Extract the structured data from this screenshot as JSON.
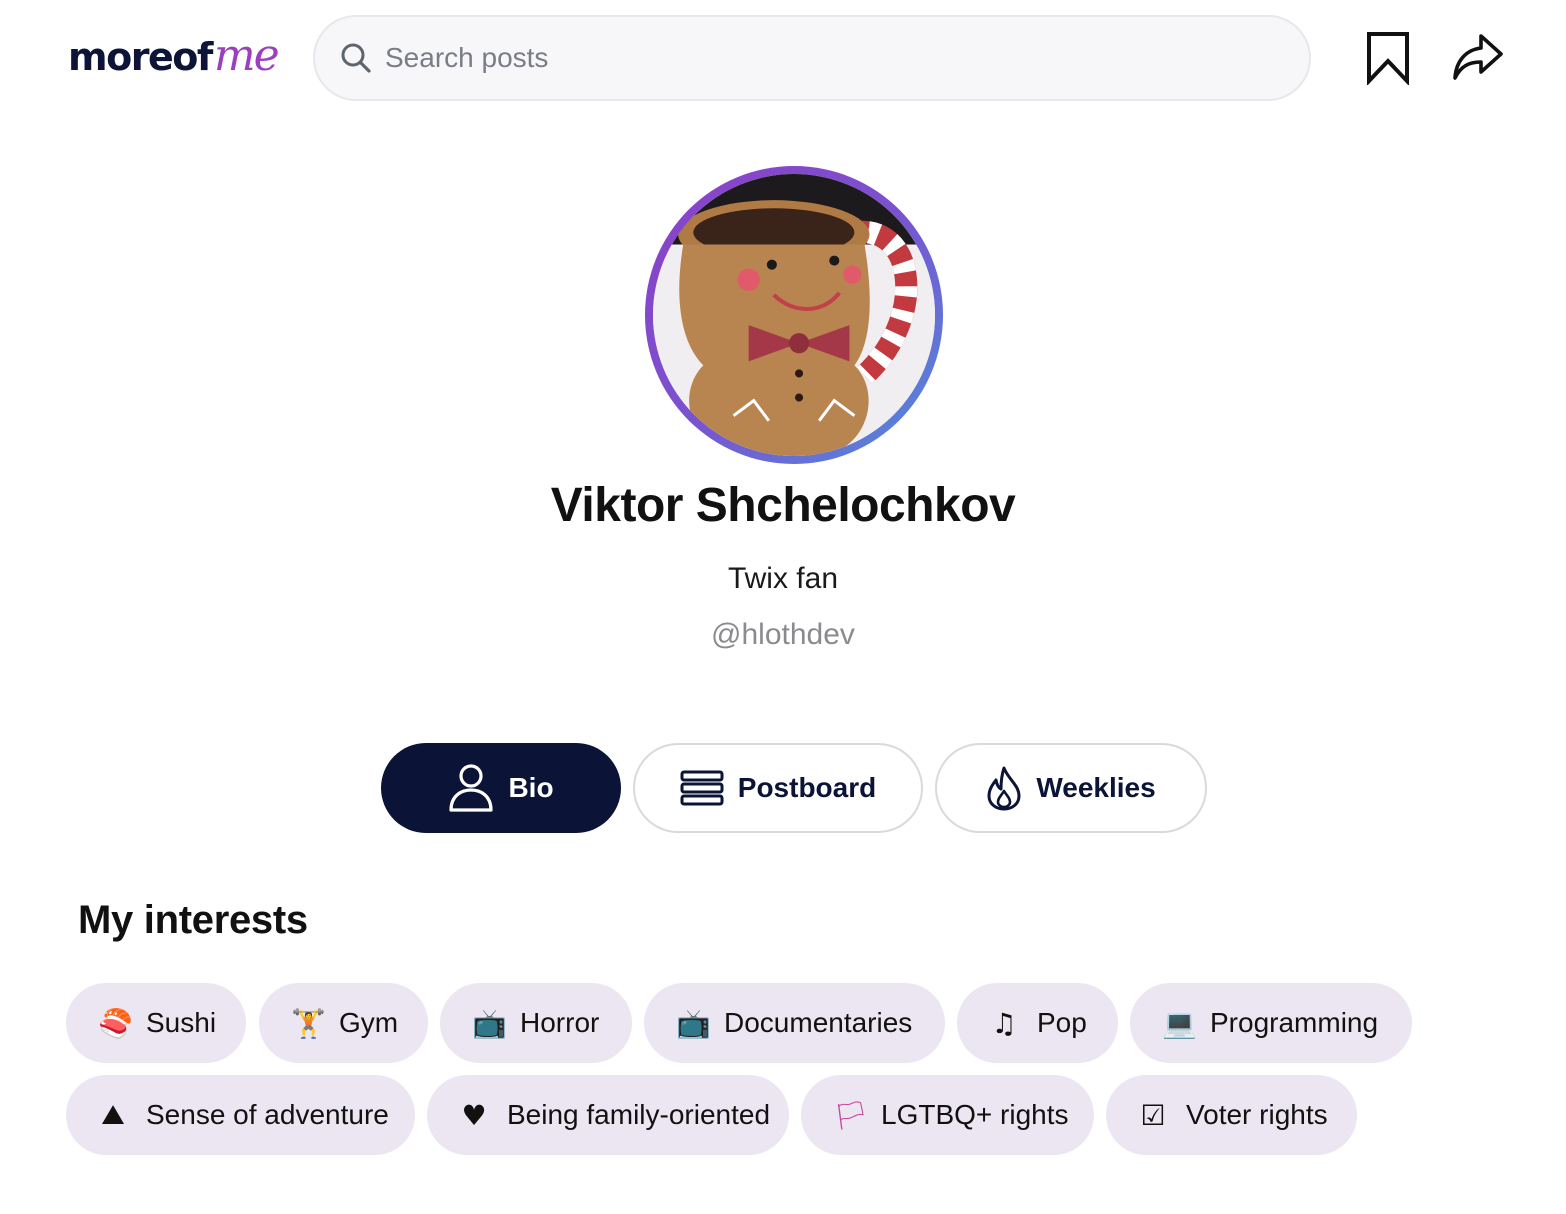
{
  "header": {
    "logo": {
      "part1": "moreof",
      "part2": "me"
    },
    "search": {
      "placeholder": "Search posts",
      "value": ""
    },
    "bookmark_icon": "bookmark-icon",
    "share_icon": "share-icon"
  },
  "profile": {
    "name": "Viktor Shchelochkov",
    "bio": "Twix fan",
    "handle": "@hlothdev",
    "avatar_ring_colors": [
      "#8d3fc7",
      "#4f8fdd"
    ]
  },
  "tabs": [
    {
      "label": "Bio",
      "icon": "person-icon",
      "active": true
    },
    {
      "label": "Postboard",
      "icon": "list-icon",
      "active": false
    },
    {
      "label": "Weeklies",
      "icon": "flame-icon",
      "active": false
    }
  ],
  "interests": {
    "title": "My interests",
    "items": [
      {
        "emoji": "🍣",
        "label": "Sushi"
      },
      {
        "emoji": "🏋",
        "label": "Gym"
      },
      {
        "emoji": "📺",
        "label": "Horror"
      },
      {
        "emoji": "📺",
        "label": "Documentaries"
      },
      {
        "emoji": "♫",
        "label": "Pop"
      },
      {
        "emoji": "💻",
        "label": "Programming"
      },
      {
        "emoji": "⛰",
        "label": "Sense of adventure"
      },
      {
        "emoji": "♥",
        "label": "Being family-oriented"
      },
      {
        "emoji": "🏳",
        "label": "LGTBQ+ rights"
      },
      {
        "emoji": "☑",
        "label": "Voter rights"
      }
    ]
  },
  "colors": {
    "brand_navy": "#0b1437",
    "brand_purple": "#9b3fc0",
    "chip_bg": "#ebe6f1"
  }
}
